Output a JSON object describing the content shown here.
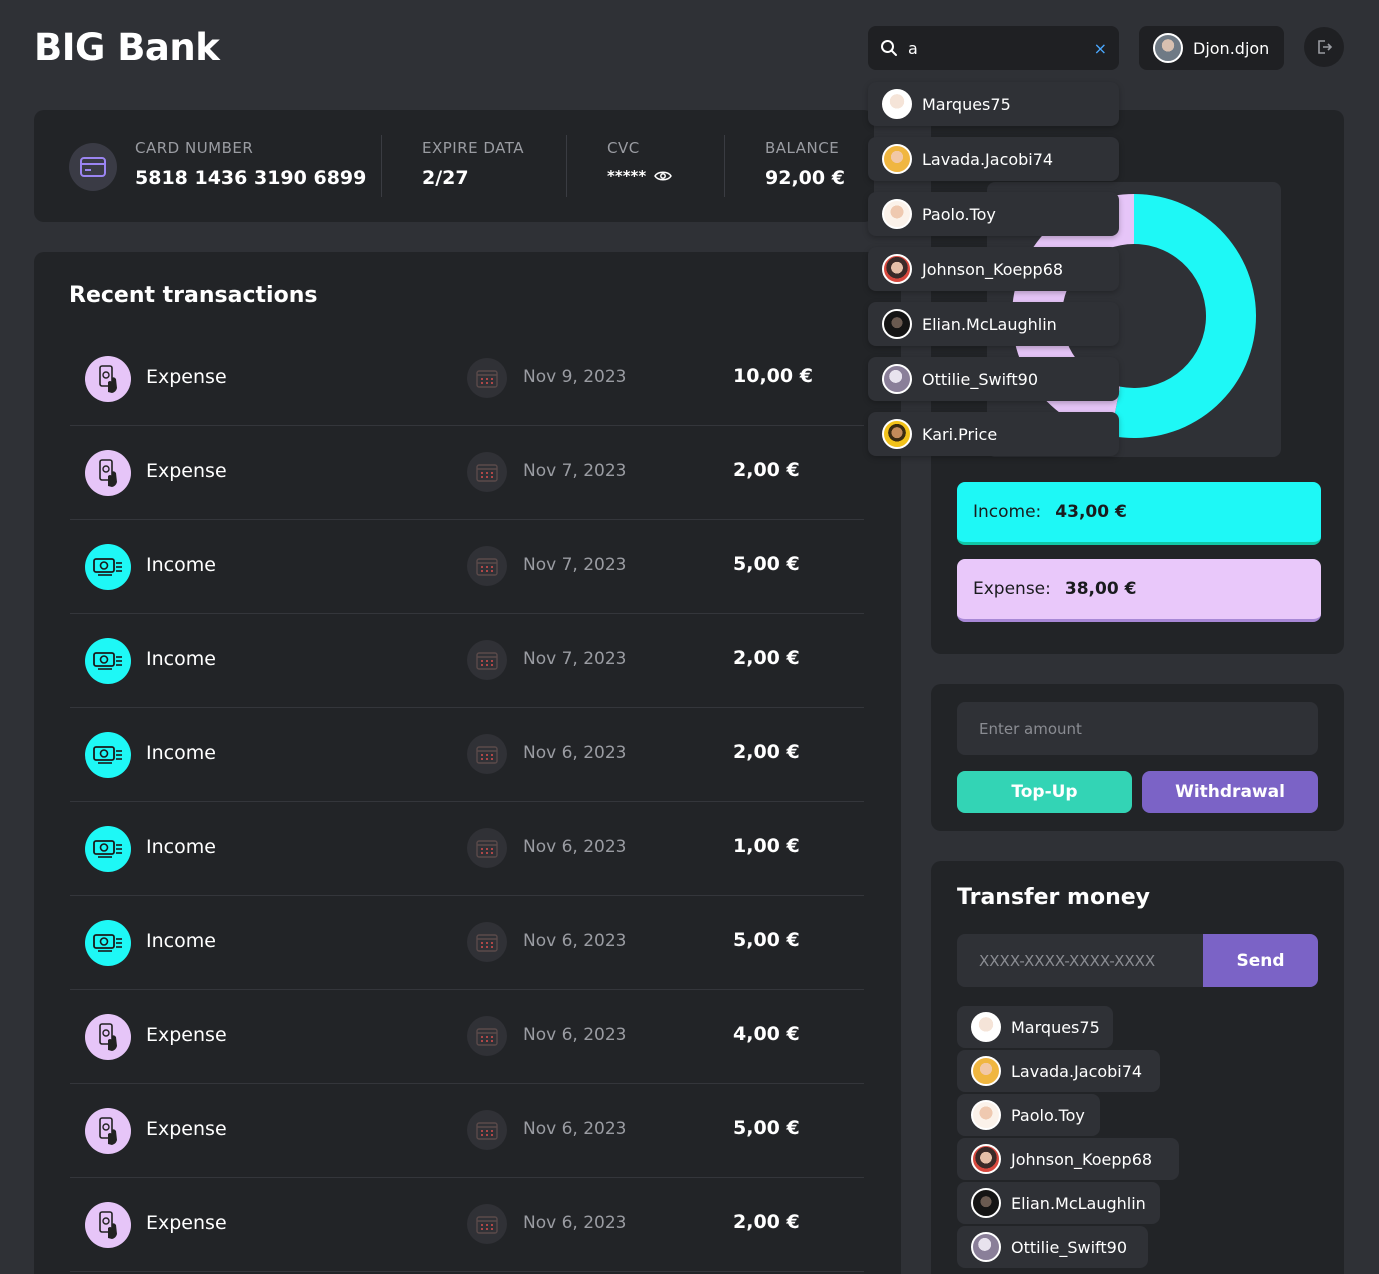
{
  "app": {
    "title": "BIG Bank"
  },
  "search": {
    "value": "a",
    "clear_icon": "×"
  },
  "user": {
    "name": "Djon.djon"
  },
  "card": {
    "number_label": "CARD NUMBER",
    "number": "5818 1436 3190 6899",
    "expire_label": "EXPIRE DATA",
    "expire": "2/27",
    "cvc_label": "CVC",
    "cvc": "*****",
    "balance_label": "BALANCE",
    "balance": "92,00 €"
  },
  "transactions": {
    "title": "Recent transactions",
    "rows": [
      {
        "type": "Expense",
        "date": "Nov 9, 2023",
        "amount": "10,00 €"
      },
      {
        "type": "Expense",
        "date": "Nov 7, 2023",
        "amount": "2,00 €"
      },
      {
        "type": "Income",
        "date": "Nov 7, 2023",
        "amount": "5,00 €"
      },
      {
        "type": "Income",
        "date": "Nov 7, 2023",
        "amount": "2,00 €"
      },
      {
        "type": "Income",
        "date": "Nov 6, 2023",
        "amount": "2,00 €"
      },
      {
        "type": "Income",
        "date": "Nov 6, 2023",
        "amount": "1,00 €"
      },
      {
        "type": "Income",
        "date": "Nov 6, 2023",
        "amount": "5,00 €"
      },
      {
        "type": "Expense",
        "date": "Nov 6, 2023",
        "amount": "4,00 €"
      },
      {
        "type": "Expense",
        "date": "Nov 6, 2023",
        "amount": "5,00 €"
      },
      {
        "type": "Expense",
        "date": "Nov 6, 2023",
        "amount": "2,00 €"
      }
    ]
  },
  "summary": {
    "income_label": "Income:",
    "income_value": "43,00 €",
    "expense_label": "Expense:",
    "expense_value": "38,00 €"
  },
  "chart_data": {
    "type": "pie",
    "categories": [
      "Income",
      "Expense"
    ],
    "values": [
      43,
      38
    ],
    "colors": [
      "#1ef8f6",
      "#e6c5f8"
    ]
  },
  "amount_form": {
    "placeholder": "Enter amount",
    "topup_label": "Top-Up",
    "withdraw_label": "Withdrawal"
  },
  "transfer": {
    "title": "Transfer money",
    "placeholder": "XXXX-XXXX-XXXX-XXXX",
    "send_label": "Send"
  },
  "users": [
    "Marques75",
    "Lavada.Jacobi74",
    "Paolo.Toy",
    "Johnson_Koepp68",
    "Elian.McLaughlin",
    "Ottilie_Swift90",
    "Kari.Price"
  ],
  "colors": {
    "accent_income": "#1ef8f6",
    "accent_expense": "#e6c5f8",
    "purple": "#7b63c6",
    "teal": "#33d4b5"
  }
}
